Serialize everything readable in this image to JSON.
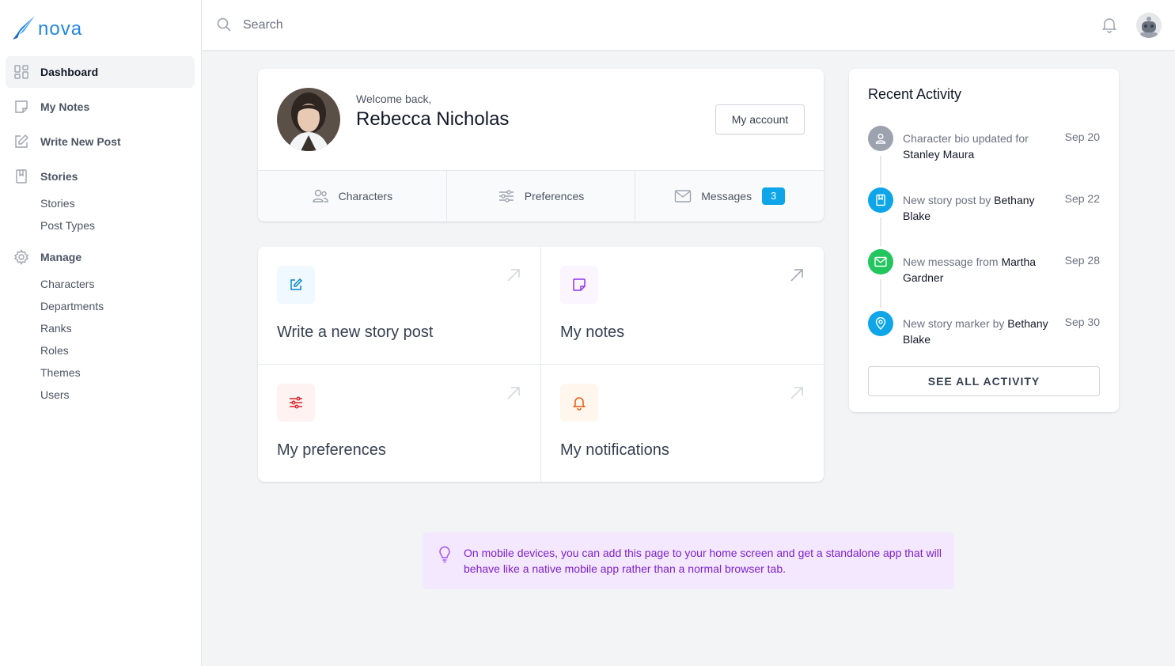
{
  "app": {
    "name": "nova",
    "brand_color": "#1e88e5"
  },
  "topbar": {
    "search_placeholder": "Search"
  },
  "sidebar": {
    "items": [
      {
        "label": "Dashboard",
        "icon": "grid-icon",
        "active": true
      },
      {
        "label": "My Notes",
        "icon": "note-icon"
      },
      {
        "label": "Write New Post",
        "icon": "pencil-square-icon"
      },
      {
        "label": "Stories",
        "icon": "book-icon",
        "children": [
          "Stories",
          "Post Types"
        ]
      },
      {
        "label": "Manage",
        "icon": "gear-icon",
        "children": [
          "Characters",
          "Departments",
          "Ranks",
          "Roles",
          "Themes",
          "Users"
        ]
      }
    ]
  },
  "welcome": {
    "greeting": "Welcome back,",
    "name": "Rebecca Nicholas",
    "account_button": "My account",
    "tabs": [
      {
        "label": "Characters",
        "icon": "users-icon"
      },
      {
        "label": "Preferences",
        "icon": "sliders-icon"
      },
      {
        "label": "Messages",
        "icon": "envelope-icon",
        "badge": "3"
      }
    ]
  },
  "quick_links": [
    {
      "label": "Write a new story post",
      "icon": "pencil-square-icon",
      "color": "#0284c7",
      "bg": "#f0f9ff"
    },
    {
      "label": "My notes",
      "icon": "note-icon",
      "color": "#9333ea",
      "bg": "#faf5ff"
    },
    {
      "label": "My preferences",
      "icon": "sliders-icon",
      "color": "#dc2626",
      "bg": "#fef2f2"
    },
    {
      "label": "My notifications",
      "icon": "bell-icon",
      "color": "#ea580c",
      "bg": "#fff7ed"
    }
  ],
  "activity": {
    "title": "Recent Activity",
    "items": [
      {
        "text": "Character bio updated for ",
        "strong": "Stanley Maura",
        "date": "Sep 20",
        "icon": "user-icon",
        "color": "#9ca3af"
      },
      {
        "text": "New story post by ",
        "strong": "Bethany Blake",
        "date": "Sep 22",
        "icon": "book-icon",
        "color": "#0ea5e9"
      },
      {
        "text": "New message from ",
        "strong": "Martha Gardner",
        "date": "Sep 28",
        "icon": "envelope-icon",
        "color": "#22c55e"
      },
      {
        "text": "New story marker by ",
        "strong": "Bethany Blake",
        "date": "Sep 30",
        "icon": "location-pin-icon",
        "color": "#0ea5e9"
      }
    ],
    "see_all": "SEE ALL ACTIVITY"
  },
  "tip": {
    "text": "On mobile devices, you can add this page to your home screen and get a standalone app that will behave like a native mobile app rather than a normal browser tab.",
    "icon": "lightbulb-icon"
  }
}
